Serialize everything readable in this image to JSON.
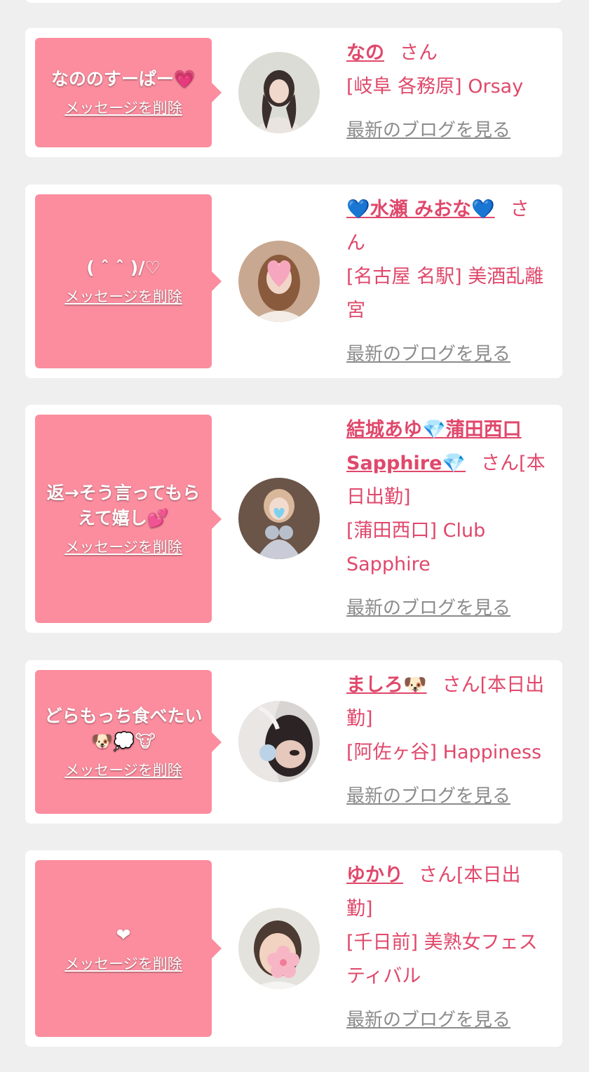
{
  "delete_label": "メッセージを削除",
  "blog_label": "最新のブログを見る",
  "san_suffix": "さん",
  "cards": [
    {
      "message": "なののすーぱー💗",
      "name_prefix": "",
      "name": "なの",
      "name_suffix_icon": "",
      "name_extra": "",
      "honorific": "さん",
      "area": "[岐阜 各務原] Orsay"
    },
    {
      "message": "( ˆ ˆ )/♡",
      "name_prefix": "💙",
      "name": "水瀬 みおな",
      "name_suffix_icon": "💙",
      "name_extra": "",
      "honorific": "さん",
      "area": "[名古屋 名駅] 美酒乱離宮"
    },
    {
      "message": "返→そう言ってもらえて嬉し💕",
      "name_prefix": "",
      "name": "結城あゆ💎蒲田西口 Sapphire💎",
      "name_suffix_icon": "",
      "name_extra": "",
      "honorific": "さん[本日出勤]",
      "area": "[蒲田西口] Club Sapphire"
    },
    {
      "message": "どらもっち食べたい🐶💭🐮",
      "name_prefix": "",
      "name": "ましろ🐶",
      "name_suffix_icon": "",
      "name_extra": "",
      "honorific": "さん[本日出勤]",
      "area": "[阿佐ヶ谷] Happiness"
    },
    {
      "message": "❤",
      "name_prefix": "",
      "name": "ゆかり",
      "name_suffix_icon": "",
      "name_extra": "",
      "honorific": "さん[本日出勤]",
      "area": "[千日前] 美熟女フェスティバル"
    }
  ],
  "colors": {
    "bubble": "#fb8d9e",
    "name": "#e0486b",
    "blog_link": "#8b8b8b",
    "background": "#efefef"
  }
}
